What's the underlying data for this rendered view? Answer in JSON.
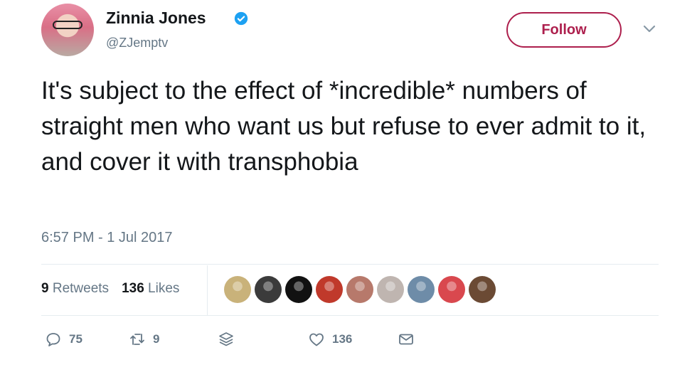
{
  "author": {
    "name": "Zinnia Jones",
    "handle": "@ZJemptv",
    "verified": true
  },
  "follow_button_label": "Follow",
  "tweet": {
    "text": "It's subject to the effect of *incredible* numbers of straight men who want us but refuse to ever admit to it, and cover it with transphobia",
    "timestamp": "6:57 PM - 1 Jul 2017"
  },
  "stats": {
    "retweets_count": "9",
    "retweets_label": "Retweets",
    "likes_count": "136",
    "likes_label": "Likes"
  },
  "likers": [
    {
      "name": "liker-avatar-1",
      "color": "#c9b27a"
    },
    {
      "name": "liker-avatar-2",
      "color": "#3b3b3b"
    },
    {
      "name": "liker-avatar-3",
      "color": "#111111"
    },
    {
      "name": "liker-avatar-4",
      "color": "#c0392b"
    },
    {
      "name": "liker-avatar-5",
      "color": "#b7796b"
    },
    {
      "name": "liker-avatar-6",
      "color": "#bfb5b0"
    },
    {
      "name": "liker-avatar-7",
      "color": "#6e8ca8"
    },
    {
      "name": "liker-avatar-8",
      "color": "#d9484e"
    },
    {
      "name": "liker-avatar-9",
      "color": "#6b4a34"
    }
  ],
  "actions": {
    "reply_count": "75",
    "retweet_count": "9",
    "like_count": "136"
  },
  "colors": {
    "accent": "#ad1f4d",
    "verified_blue": "#1da1f2",
    "muted_text": "#657786"
  }
}
